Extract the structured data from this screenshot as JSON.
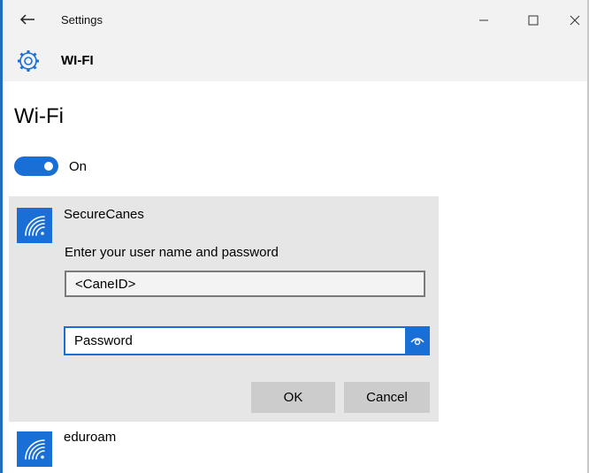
{
  "window": {
    "title": "Settings"
  },
  "header": {
    "title": "WI-FI"
  },
  "page": {
    "title": "Wi-Fi"
  },
  "wifi_toggle": {
    "state_label": "On",
    "on": true
  },
  "networks": [
    {
      "name": "SecureCanes",
      "expanded": true,
      "prompt": "Enter your user name and password",
      "username_value": "<CaneID>",
      "password_placeholder": "Password",
      "ok_label": "OK",
      "cancel_label": "Cancel"
    },
    {
      "name": "eduroam",
      "expanded": false
    }
  ],
  "colors": {
    "accent": "#1a6fd6",
    "panel_bg": "#e6e6e6",
    "button_bg": "#cccccc",
    "titlebar_bg": "#f2f2f2"
  },
  "icons": {
    "back": "back-arrow-icon",
    "minimize": "minimize-icon",
    "maximize": "maximize-icon",
    "close": "close-icon",
    "settings": "gear-icon",
    "wifi": "wifi-signal-icon",
    "reveal_password": "eye-icon"
  }
}
